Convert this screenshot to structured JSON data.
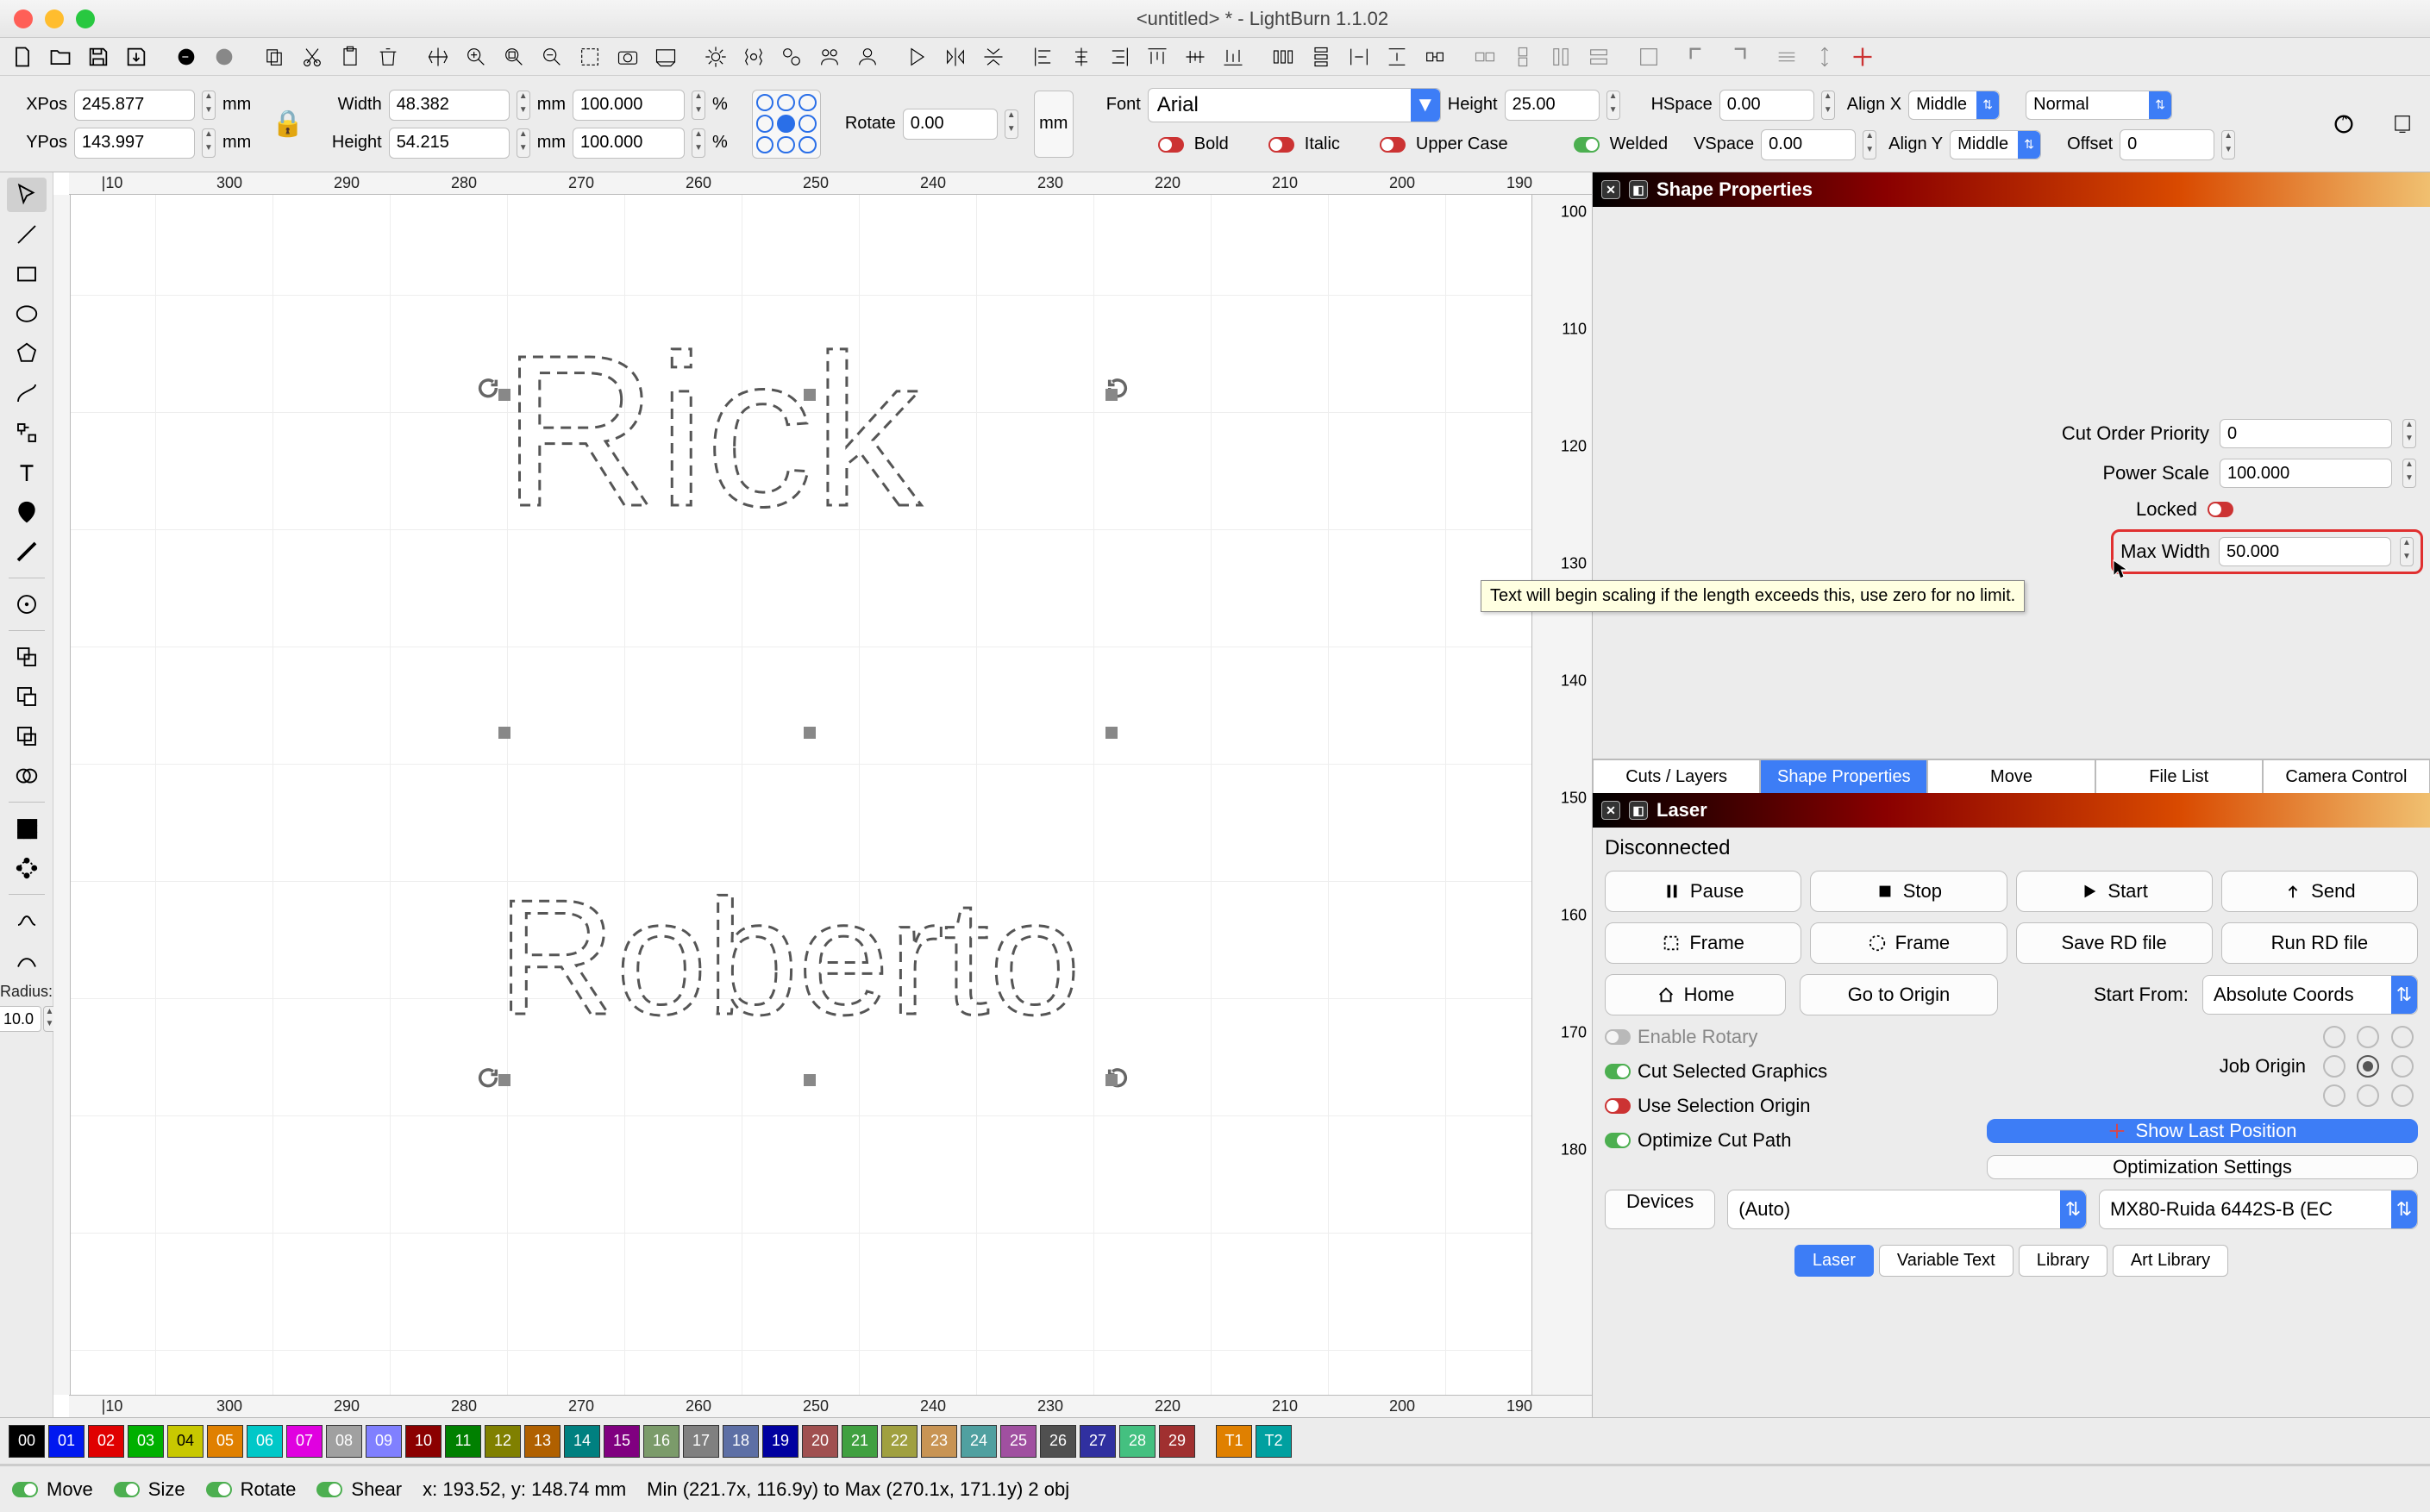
{
  "title": "<untitled> * - LightBurn 1.1.02",
  "toolbar_icons": [
    "new",
    "open",
    "save",
    "import",
    "go",
    "go-laser",
    "copy",
    "cut",
    "paste",
    "delete",
    "pan",
    "zoom-in",
    "zoom-frame",
    "zoom-out",
    "selection-frame",
    "camera",
    "preview",
    "settings",
    "device-settings",
    "gears",
    "social",
    "user",
    "play",
    "mirror-h",
    "mirror-v",
    "align-left",
    "align-center-h",
    "align-right",
    "align-top",
    "align-center-v",
    "align-bottom",
    "distribute-h",
    "distribute-v",
    "distribute-h2",
    "distribute-v2",
    "move-together",
    "dock-h",
    "dock-v",
    "2col",
    "2row",
    "path-union",
    "path-subtract",
    "path-intersect",
    "group",
    "ungroup",
    "crosshair"
  ],
  "position": {
    "xpos_label": "XPos",
    "xpos": "245.877",
    "ypos_label": "YPos",
    "ypos": "143.997",
    "width_label": "Width",
    "width": "48.382",
    "height_label": "Height",
    "height": "54.215",
    "scale_w": "100.000",
    "scale_h": "100.000",
    "unit": "mm",
    "pct": "%",
    "rotate_label": "Rotate",
    "rotate": "0.00"
  },
  "text_toolbar": {
    "font_label": "Font",
    "font": "Arial",
    "height_label": "Height",
    "height": "25.00",
    "hspace_label": "HSpace",
    "hspace": "0.00",
    "vspace_label": "VSpace",
    "vspace": "0.00",
    "alignx_label": "Align X",
    "alignx": "Middle",
    "aligny_label": "Align Y",
    "aligny": "Middle",
    "normal": "Normal",
    "offset_label": "Offset",
    "offset": "0",
    "bold": "Bold",
    "italic": "Italic",
    "upper": "Upper Case",
    "welded": "Welded"
  },
  "canvas": {
    "ruler_top": [
      "|10",
      "300",
      "290",
      "280",
      "270",
      "260",
      "250",
      "240",
      "230",
      "220",
      "210",
      "200",
      "190"
    ],
    "ruler_right": [
      "100",
      "110",
      "120",
      "130",
      "140",
      "150",
      "160",
      "170",
      "180"
    ],
    "ruler_left": [
      "100",
      "110",
      "120",
      "130",
      "140",
      "150",
      "160",
      "170",
      "180"
    ],
    "text1": "Rick",
    "text2": "Roberto"
  },
  "shape_panel_title": "Shape Properties",
  "shape_props": {
    "cut_order_label": "Cut Order Priority",
    "cut_order": "0",
    "power_label": "Power Scale",
    "power": "100.000",
    "locked_label": "Locked",
    "maxw_label": "Max Width",
    "maxw": "50.000"
  },
  "tooltip": "Text will begin scaling if the length exceeds this, use zero for no limit.",
  "shape_tabs": [
    "Cuts / Layers",
    "Shape Properties",
    "Move",
    "File List",
    "Camera Control"
  ],
  "shape_tab_active": 1,
  "laser": {
    "title": "Laser",
    "status": "Disconnected",
    "pause": "Pause",
    "stop": "Stop",
    "start": "Start",
    "send": "Send",
    "frame": "Frame",
    "save_rd": "Save RD file",
    "run_rd": "Run RD file",
    "home": "Home",
    "go_origin": "Go to Origin",
    "start_from_label": "Start From:",
    "start_from": "Absolute Coords",
    "enable_rotary": "Enable Rotary",
    "cut_selected": "Cut Selected Graphics",
    "use_selection": "Use Selection Origin",
    "optimize": "Optimize Cut Path",
    "show_last": "Show Last Position",
    "opt_settings": "Optimization Settings",
    "job_origin_label": "Job Origin",
    "devices": "Devices",
    "auto": "(Auto)",
    "machine": "MX80-Ruida 6442S-B (EC"
  },
  "laser_tabs": [
    "Laser",
    "Variable Text",
    "Library",
    "Art Library"
  ],
  "laser_tab_active": 0,
  "palette": [
    {
      "n": "00",
      "c": "#000000"
    },
    {
      "n": "01",
      "c": "#0018f0"
    },
    {
      "n": "02",
      "c": "#e00000"
    },
    {
      "n": "03",
      "c": "#00b000"
    },
    {
      "n": "04",
      "c": "#c8c800"
    },
    {
      "n": "05",
      "c": "#e08000"
    },
    {
      "n": "06",
      "c": "#00c8c8"
    },
    {
      "n": "07",
      "c": "#e000e0"
    },
    {
      "n": "08",
      "c": "#a0a0a0"
    },
    {
      "n": "09",
      "c": "#8080ff"
    },
    {
      "n": "10",
      "c": "#8b0000"
    },
    {
      "n": "11",
      "c": "#008000"
    },
    {
      "n": "12",
      "c": "#808000"
    },
    {
      "n": "13",
      "c": "#b06000"
    },
    {
      "n": "14",
      "c": "#008080"
    },
    {
      "n": "15",
      "c": "#800080"
    },
    {
      "n": "16",
      "c": "#7b9b6a"
    },
    {
      "n": "17",
      "c": "#808080"
    },
    {
      "n": "18",
      "c": "#5d6fa5"
    },
    {
      "n": "19",
      "c": "#0000a0"
    },
    {
      "n": "20",
      "c": "#a05050"
    },
    {
      "n": "21",
      "c": "#40a040"
    },
    {
      "n": "22",
      "c": "#a0a040"
    },
    {
      "n": "23",
      "c": "#c89454"
    },
    {
      "n": "24",
      "c": "#50a0a0"
    },
    {
      "n": "25",
      "c": "#a050a0"
    },
    {
      "n": "26",
      "c": "#505050"
    },
    {
      "n": "27",
      "c": "#3030a0"
    },
    {
      "n": "28",
      "c": "#44c080"
    },
    {
      "n": "29",
      "c": "#a03030"
    }
  ],
  "palette_tools": [
    {
      "n": "T1",
      "c": "#e08000"
    },
    {
      "n": "T2",
      "c": "#00a0a0"
    }
  ],
  "status": {
    "move": "Move",
    "size": "Size",
    "rotate": "Rotate",
    "shear": "Shear",
    "pos": "x: 193.52, y: 148.74 mm",
    "bounds": "Min (221.7x, 116.9y) to Max (270.1x, 171.1y)  2 obj"
  },
  "radius_label": "Radius:",
  "radius_value": "10.0"
}
